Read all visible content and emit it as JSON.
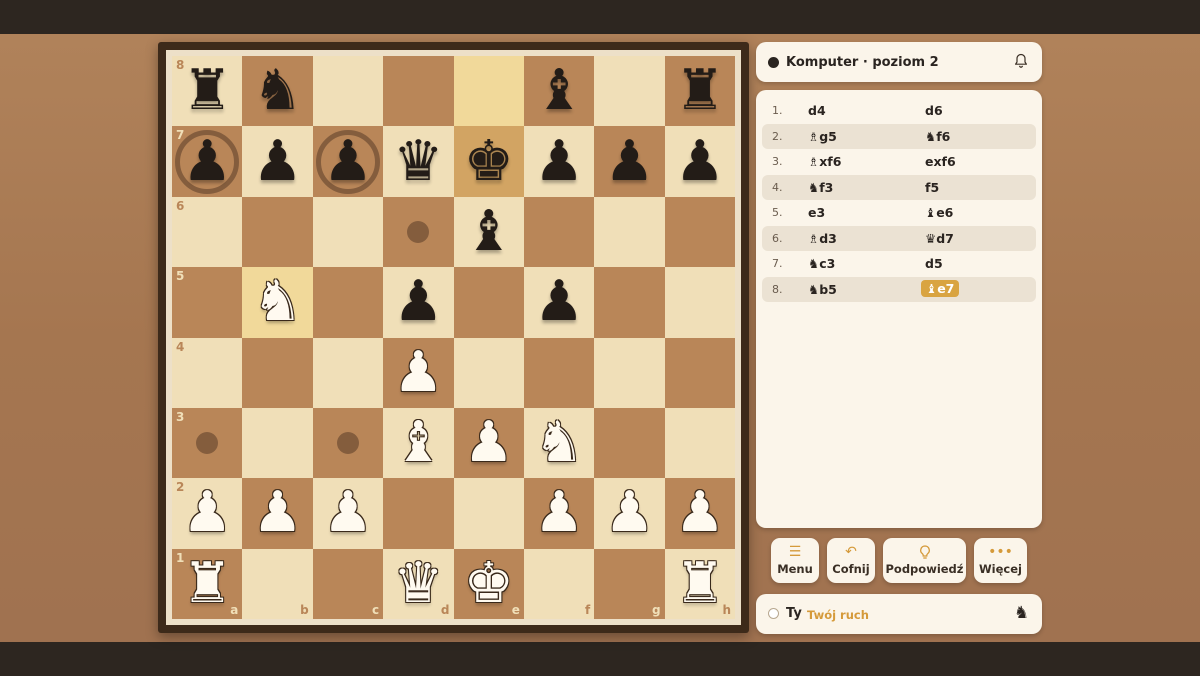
{
  "opponent": {
    "name": "Komputer · poziom 2"
  },
  "player": {
    "name": "Ty",
    "status": "Twój ruch"
  },
  "board": {
    "rank_labels": [
      "8",
      "7",
      "6",
      "5",
      "4",
      "3",
      "2",
      "1"
    ],
    "file_labels": [
      "a",
      "b",
      "c",
      "d",
      "e",
      "f",
      "g",
      "h"
    ],
    "position": [
      [
        "bR",
        "bN",
        "",
        "",
        "",
        "bB",
        "",
        "bR"
      ],
      [
        "bP",
        "bP",
        "bP",
        "bQ",
        "bK",
        "bP",
        "bP",
        "bP"
      ],
      [
        "",
        "",
        "",
        "",
        "bB",
        "",
        "",
        ""
      ],
      [
        "",
        "wN",
        "",
        "bP",
        "",
        "bP",
        "",
        ""
      ],
      [
        "",
        "",
        "",
        "wP",
        "",
        "",
        "",
        ""
      ],
      [
        "",
        "",
        "",
        "wB",
        "wP",
        "wN",
        "",
        ""
      ],
      [
        "wP",
        "wP",
        "wP",
        "",
        "",
        "wP",
        "wP",
        "wP"
      ],
      [
        "wR",
        "",
        "",
        "wQ",
        "wK",
        "",
        "",
        "wR"
      ]
    ],
    "highlighted_squares": [
      "e8",
      "e7",
      "b5"
    ],
    "move_hints_dots": [
      "d6",
      "a3",
      "c3"
    ],
    "move_hints_rings": [
      "a7",
      "c7"
    ]
  },
  "moves": [
    {
      "num": "1.",
      "white": "d4",
      "black": "d6"
    },
    {
      "num": "2.",
      "white": "♗g5",
      "black": "♞f6"
    },
    {
      "num": "3.",
      "white": "♗xf6",
      "black": "exf6"
    },
    {
      "num": "4.",
      "white": "♞f3",
      "black": "f5"
    },
    {
      "num": "5.",
      "white": "e3",
      "black": "♝e6"
    },
    {
      "num": "6.",
      "white": "♗d3",
      "black": "♛d7"
    },
    {
      "num": "7.",
      "white": "♞c3",
      "black": "d5"
    },
    {
      "num": "8.",
      "white": "♞b5",
      "black": "♝e7"
    }
  ],
  "current_move_index": 7,
  "buttons": {
    "menu": {
      "label": "Menu",
      "icon": "menu-icon"
    },
    "undo": {
      "label": "Cofnij",
      "icon": "undo-icon"
    },
    "hint": {
      "label": "Podpowiedź",
      "icon": "lightbulb-icon"
    },
    "more": {
      "label": "Więcej",
      "icon": "more-icon"
    }
  },
  "colors": {
    "light_square": "#f0dfb8",
    "dark_square": "#b98658",
    "accent": "#d59a3a"
  }
}
